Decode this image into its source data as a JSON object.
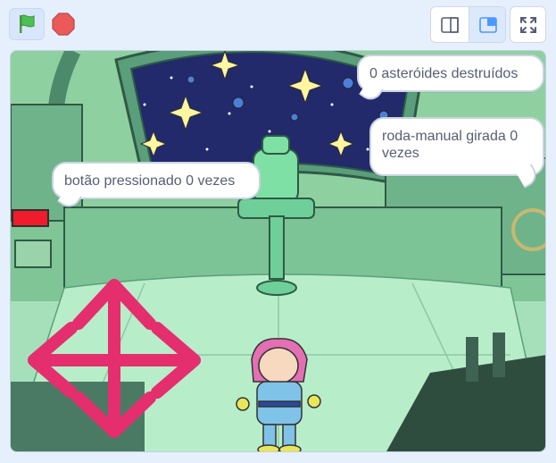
{
  "toolbar": {
    "green_flag": "green-flag-icon",
    "stop": "stop-icon",
    "small_stage": "small-stage-icon",
    "normal_stage": "normal-stage-icon",
    "fullscreen": "fullscreen-icon",
    "colors": {
      "flag": "#4cbf56",
      "stop": "#ec5959",
      "accent": "#4c97ff"
    }
  },
  "stage": {
    "bubbles": {
      "asteroids": "0 asteróides destruídos",
      "wheel": "roda-manual girada 0 vezes",
      "button": "botão pressionado 0 vezes"
    },
    "sprites": {
      "arrows": "arrow-pad",
      "character": "astronaut-kid"
    }
  }
}
